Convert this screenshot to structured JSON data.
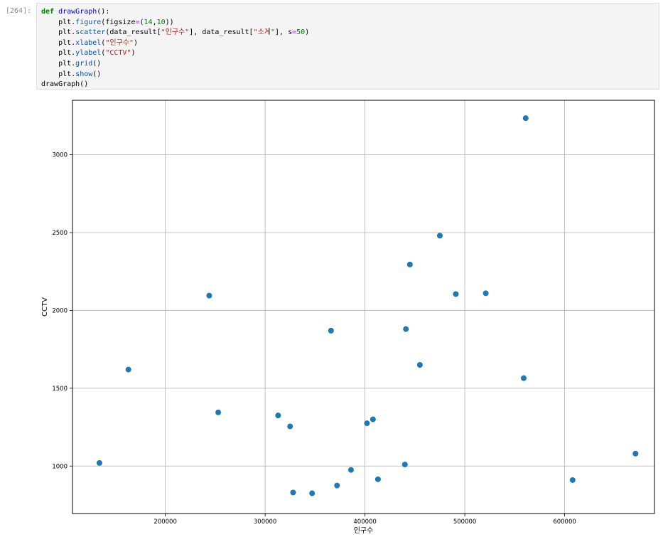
{
  "cell": {
    "prompt": "[264]:",
    "code_lines": [
      [
        {
          "t": "def",
          "c": "kw"
        },
        {
          "t": " ",
          "c": "plain"
        },
        {
          "t": "drawGraph",
          "c": "fn"
        },
        {
          "t": "():",
          "c": "plain"
        }
      ],
      [
        {
          "t": "    plt.",
          "c": "plain"
        },
        {
          "t": "figure",
          "c": "attr"
        },
        {
          "t": "(figsize",
          "c": "plain"
        },
        {
          "t": "=",
          "c": "op"
        },
        {
          "t": "(",
          "c": "plain"
        },
        {
          "t": "14",
          "c": "num"
        },
        {
          "t": ",",
          "c": "plain"
        },
        {
          "t": "10",
          "c": "num"
        },
        {
          "t": "))",
          "c": "plain"
        }
      ],
      [
        {
          "t": "    plt.",
          "c": "plain"
        },
        {
          "t": "scatter",
          "c": "attr"
        },
        {
          "t": "(data_result[",
          "c": "plain"
        },
        {
          "t": "\"인구수\"",
          "c": "str"
        },
        {
          "t": "], data_result[",
          "c": "plain"
        },
        {
          "t": "\"소계\"",
          "c": "str"
        },
        {
          "t": "], s",
          "c": "plain"
        },
        {
          "t": "=",
          "c": "op"
        },
        {
          "t": "50",
          "c": "num"
        },
        {
          "t": ")",
          "c": "plain"
        }
      ],
      [
        {
          "t": "    plt.",
          "c": "plain"
        },
        {
          "t": "xlabel",
          "c": "attr"
        },
        {
          "t": "(",
          "c": "plain"
        },
        {
          "t": "\"인구수\"",
          "c": "str"
        },
        {
          "t": ")",
          "c": "plain"
        }
      ],
      [
        {
          "t": "    plt.",
          "c": "plain"
        },
        {
          "t": "ylabel",
          "c": "attr"
        },
        {
          "t": "(",
          "c": "plain"
        },
        {
          "t": "\"CCTV\"",
          "c": "str"
        },
        {
          "t": ")",
          "c": "plain"
        }
      ],
      [
        {
          "t": "    plt.",
          "c": "plain"
        },
        {
          "t": "grid",
          "c": "attr"
        },
        {
          "t": "()",
          "c": "plain"
        }
      ],
      [
        {
          "t": "    plt.",
          "c": "plain"
        },
        {
          "t": "show",
          "c": "attr"
        },
        {
          "t": "()",
          "c": "plain"
        }
      ],
      [
        {
          "t": "drawGraph()",
          "c": "plain"
        }
      ]
    ]
  },
  "colors": {
    "marker": "#1f77b4",
    "grid": "#b0b0b0",
    "axes": "#000000",
    "code_bg": "#f4f4f4",
    "keyword": "#008000",
    "function": "#0000ff",
    "string": "#ba2121",
    "operator": "#aa22ff"
  },
  "chart_data": {
    "type": "scatter",
    "title": "",
    "xlabel": "인구수",
    "ylabel": "CCTV",
    "xlim": [
      107000,
      690000
    ],
    "ylim": [
      695000,
      3350
    ],
    "xticks": [
      200000,
      300000,
      400000,
      500000,
      600000
    ],
    "xtick_labels": [
      "200000",
      "300000",
      "400000",
      "500000",
      "600000"
    ],
    "yticks": [
      1000,
      1500,
      2000,
      2500,
      3000
    ],
    "ytick_labels": [
      "1000",
      "1500",
      "2000",
      "2500",
      "3000"
    ],
    "grid": true,
    "legend": "none",
    "points": [
      {
        "x": 134000,
        "y": 1020
      },
      {
        "x": 163000,
        "y": 1620
      },
      {
        "x": 244000,
        "y": 2095
      },
      {
        "x": 253000,
        "y": 1345
      },
      {
        "x": 313000,
        "y": 1325
      },
      {
        "x": 325000,
        "y": 1255
      },
      {
        "x": 328000,
        "y": 830
      },
      {
        "x": 347000,
        "y": 825
      },
      {
        "x": 366000,
        "y": 1870
      },
      {
        "x": 372000,
        "y": 875
      },
      {
        "x": 386000,
        "y": 975
      },
      {
        "x": 402000,
        "y": 1275
      },
      {
        "x": 408000,
        "y": 1300
      },
      {
        "x": 413000,
        "y": 915
      },
      {
        "x": 440000,
        "y": 1010
      },
      {
        "x": 441000,
        "y": 1880
      },
      {
        "x": 445000,
        "y": 2295
      },
      {
        "x": 455000,
        "y": 1650
      },
      {
        "x": 475000,
        "y": 2480
      },
      {
        "x": 491000,
        "y": 2105
      },
      {
        "x": 521000,
        "y": 2110
      },
      {
        "x": 559000,
        "y": 1565
      },
      {
        "x": 561000,
        "y": 3235
      },
      {
        "x": 608000,
        "y": 910
      },
      {
        "x": 671000,
        "y": 1080
      }
    ]
  }
}
